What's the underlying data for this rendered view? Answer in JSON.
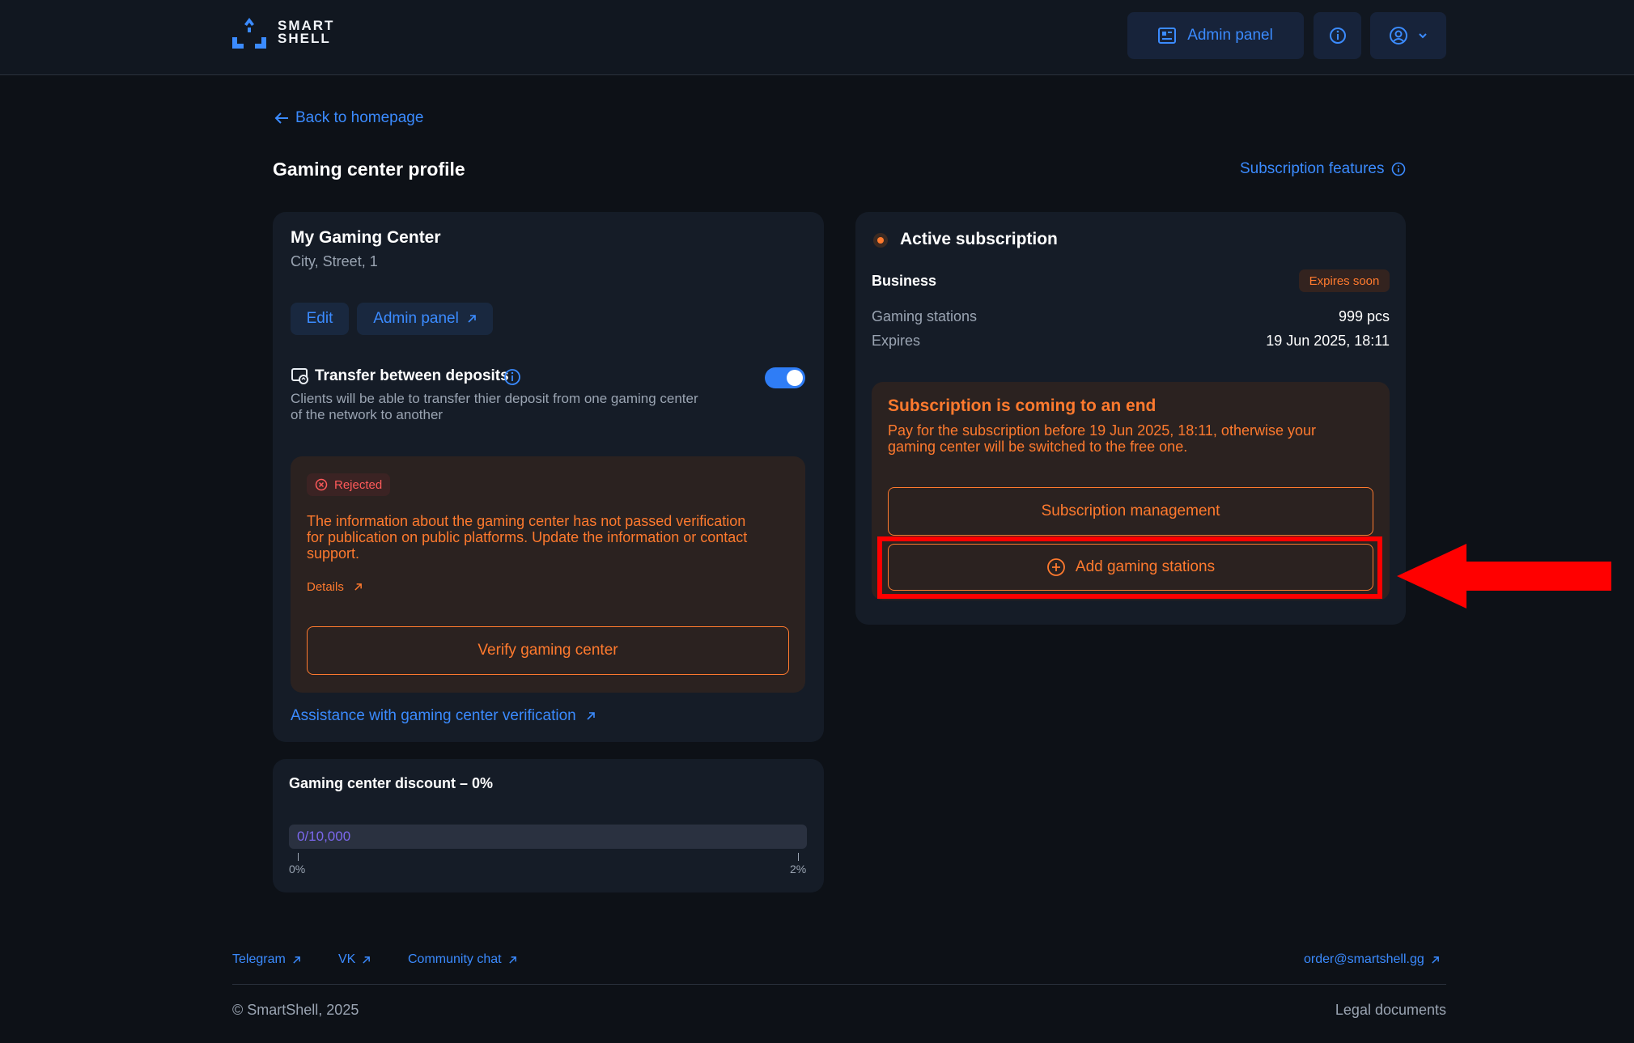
{
  "header": {
    "logo_line1": "SMART",
    "logo_line2": "SHELL",
    "admin_panel_label": "Admin panel"
  },
  "nav": {
    "back_label": "Back to homepage"
  },
  "page": {
    "title": "Gaming center profile",
    "subscription_features_label": "Subscription features"
  },
  "center": {
    "name": "My Gaming Center",
    "address": "City, Street, 1",
    "edit_label": "Edit",
    "admin_panel_label": "Admin panel",
    "transfer_title": "Transfer between deposits",
    "transfer_desc_line1": "Clients will be able to transfer thier deposit from one gaming center",
    "transfer_desc_line2": "of the network to another",
    "transfer_enabled": true,
    "status_badge": "Rejected",
    "rejection_line1": "The information about the gaming center has not passed verification",
    "rejection_line2": "for publication on public platforms. Update the information or contact",
    "rejection_line3": "support.",
    "details_label": "Details",
    "verify_label": "Verify gaming center",
    "assistance_label": "Assistance with gaming center verification"
  },
  "discount": {
    "title": "Gaming center discount – 0%",
    "progress_text": "0/10,000",
    "progress_fraction": 0,
    "scale_min": "0%",
    "scale_max": "2%"
  },
  "subscription": {
    "heading": "Active subscription",
    "plan": "Business",
    "expires_badge": "Expires soon",
    "stations_label": "Gaming stations",
    "stations_value": "999 pcs",
    "expires_label": "Expires",
    "expires_value": "19 Jun 2025, 18:11",
    "warning_title": "Subscription is coming to an end",
    "warning_line1": "Pay for the subscription before 19 Jun 2025, 18:11, otherwise your",
    "warning_line2": "gaming center will be switched to the free one.",
    "management_label": "Subscription management",
    "add_stations_label": "Add gaming stations"
  },
  "footer": {
    "telegram": "Telegram",
    "vk": "VK",
    "community": "Community chat",
    "email": "order@smartshell.gg",
    "copyright": "© SmartShell, 2025",
    "legal": "Legal documents"
  },
  "colors": {
    "accent": "#3b8bff",
    "warning": "#ff7a2e",
    "error": "#ff4d4f",
    "annotation": "#ff0000"
  }
}
